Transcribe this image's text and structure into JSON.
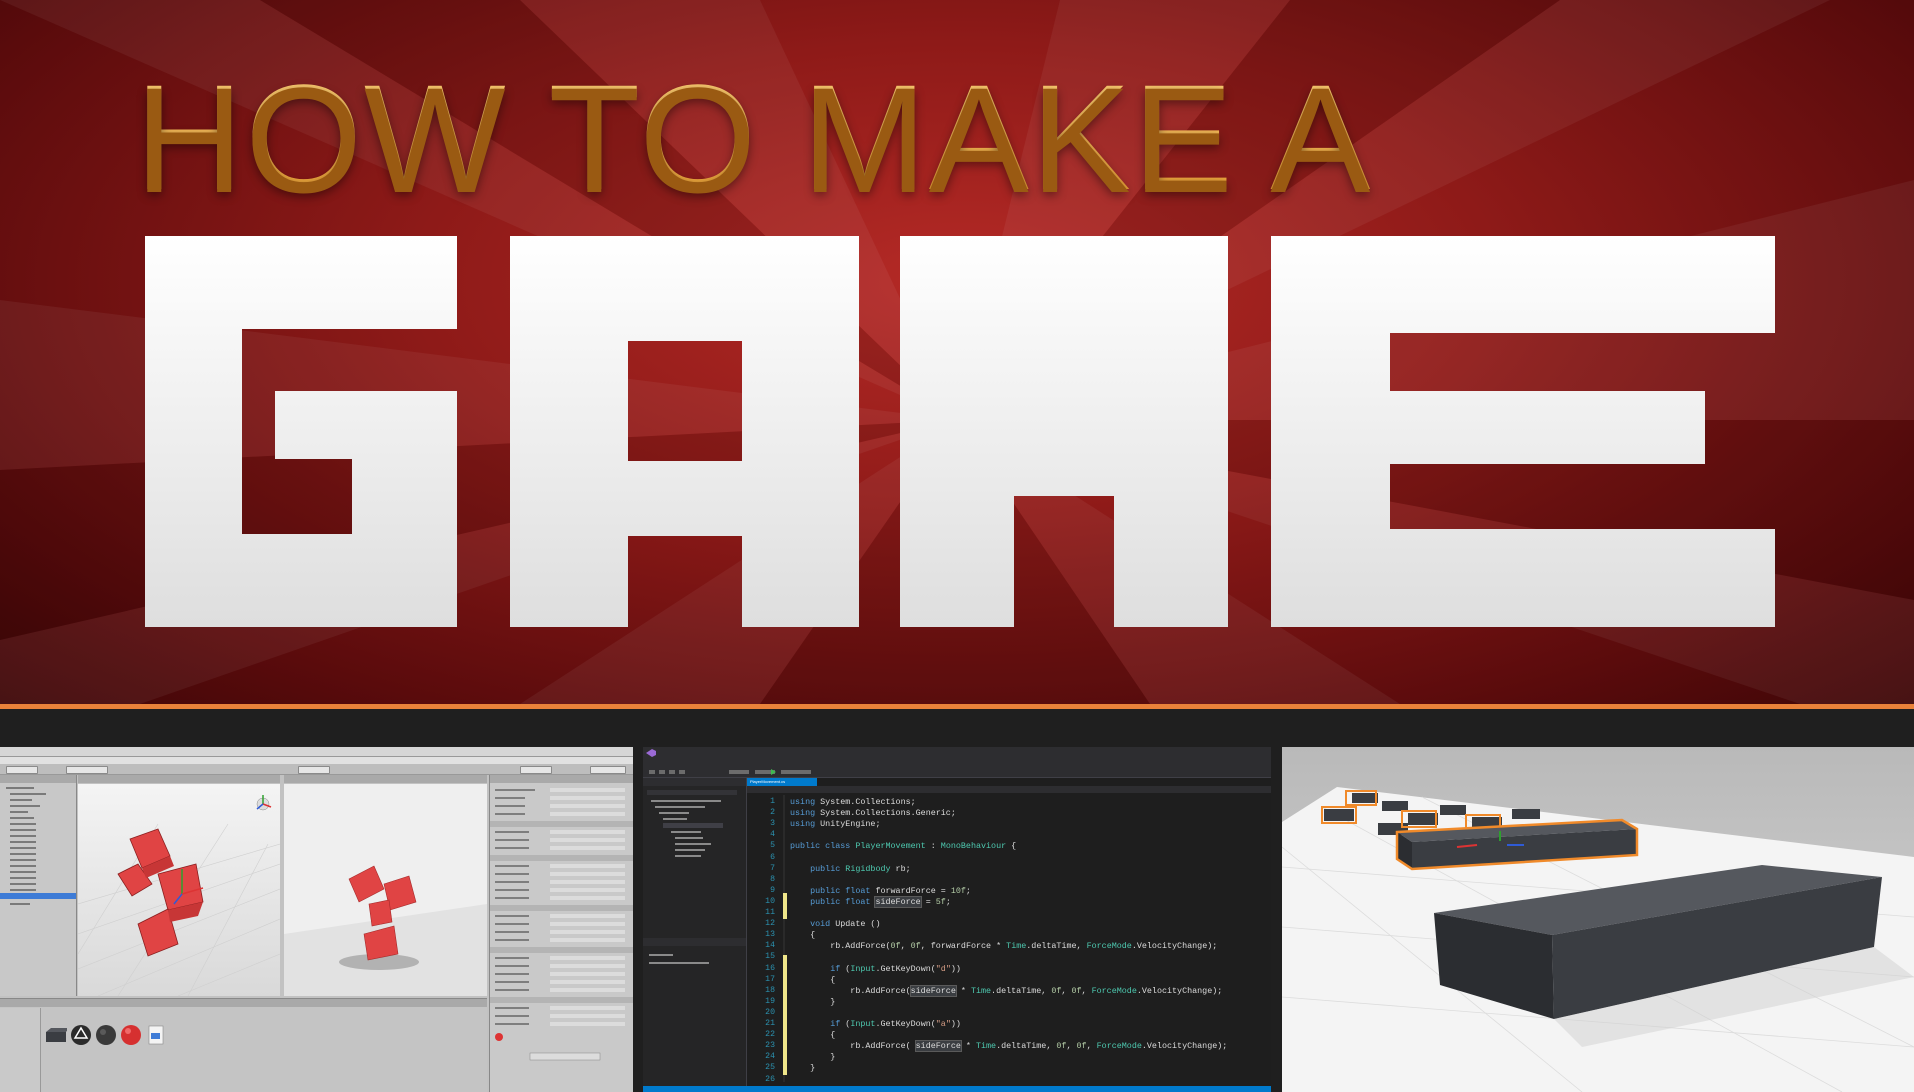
{
  "banner": {
    "subtitle": "HOW TO MAKE A",
    "title": "GAME",
    "colors": {
      "background": "#8e1a18",
      "subtitle": "#f3b24e",
      "title": "#f2f2f2",
      "rule": "#e9823a"
    }
  },
  "code_editor": {
    "tab": "PlayerMovement.cs",
    "lines": [
      {
        "n": "1",
        "segments": [
          {
            "t": "using ",
            "c": "kw"
          },
          {
            "t": "System.Collections;",
            "c": ""
          }
        ]
      },
      {
        "n": "2",
        "segments": [
          {
            "t": "using ",
            "c": "kw"
          },
          {
            "t": "System.Collections.Generic;",
            "c": ""
          }
        ]
      },
      {
        "n": "3",
        "segments": [
          {
            "t": "using ",
            "c": "kw"
          },
          {
            "t": "UnityEngine;",
            "c": ""
          }
        ]
      },
      {
        "n": "4",
        "segments": []
      },
      {
        "n": "5",
        "segments": [
          {
            "t": "public class ",
            "c": "kw"
          },
          {
            "t": "PlayerMovement",
            "c": "ty"
          },
          {
            "t": " : ",
            "c": ""
          },
          {
            "t": "MonoBehaviour",
            "c": "ty"
          },
          {
            "t": " {",
            "c": ""
          }
        ]
      },
      {
        "n": "6",
        "segments": []
      },
      {
        "n": "7",
        "segments": [
          {
            "t": "    public ",
            "c": "kw"
          },
          {
            "t": "Rigidbody",
            "c": "ty"
          },
          {
            "t": " rb;",
            "c": ""
          }
        ]
      },
      {
        "n": "8",
        "segments": []
      },
      {
        "n": "9",
        "segments": [
          {
            "t": "    public float ",
            "c": "kw"
          },
          {
            "t": "forwardForce = ",
            "c": ""
          },
          {
            "t": "10f",
            "c": "nm"
          },
          {
            "t": ";",
            "c": ""
          }
        ]
      },
      {
        "n": "10",
        "segments": [
          {
            "t": "    public float ",
            "c": "kw"
          },
          {
            "t": "sideForce",
            "c": "hl"
          },
          {
            "t": " = ",
            "c": ""
          },
          {
            "t": "5f",
            "c": "nm"
          },
          {
            "t": ";",
            "c": ""
          }
        ]
      },
      {
        "n": "11",
        "segments": []
      },
      {
        "n": "12",
        "segments": [
          {
            "t": "    void ",
            "c": "kw"
          },
          {
            "t": "Update ()",
            "c": ""
          }
        ]
      },
      {
        "n": "13",
        "segments": [
          {
            "t": "    {",
            "c": ""
          }
        ]
      },
      {
        "n": "14",
        "segments": [
          {
            "t": "        rb.AddForce(",
            "c": ""
          },
          {
            "t": "0f",
            "c": "nm"
          },
          {
            "t": ", ",
            "c": ""
          },
          {
            "t": "0f",
            "c": "nm"
          },
          {
            "t": ", forwardForce * ",
            "c": ""
          },
          {
            "t": "Time",
            "c": "ty"
          },
          {
            "t": ".deltaTime, ",
            "c": ""
          },
          {
            "t": "ForceMode",
            "c": "ty"
          },
          {
            "t": ".VelocityChange);",
            "c": ""
          }
        ]
      },
      {
        "n": "15",
        "segments": []
      },
      {
        "n": "16",
        "segments": [
          {
            "t": "        if ",
            "c": "kw"
          },
          {
            "t": "(",
            "c": ""
          },
          {
            "t": "Input",
            "c": "ty"
          },
          {
            "t": ".GetKeyDown(",
            "c": ""
          },
          {
            "t": "\"d\"",
            "c": "st"
          },
          {
            "t": "))",
            "c": ""
          }
        ]
      },
      {
        "n": "17",
        "segments": [
          {
            "t": "        {",
            "c": ""
          }
        ]
      },
      {
        "n": "18",
        "segments": [
          {
            "t": "            rb.AddForce(",
            "c": ""
          },
          {
            "t": "sideForce",
            "c": "hl"
          },
          {
            "t": " * ",
            "c": ""
          },
          {
            "t": "Time",
            "c": "ty"
          },
          {
            "t": ".deltaTime, ",
            "c": ""
          },
          {
            "t": "0f",
            "c": "nm"
          },
          {
            "t": ", ",
            "c": ""
          },
          {
            "t": "0f",
            "c": "nm"
          },
          {
            "t": ", ",
            "c": ""
          },
          {
            "t": "ForceMode",
            "c": "ty"
          },
          {
            "t": ".VelocityChange);",
            "c": ""
          }
        ]
      },
      {
        "n": "19",
        "segments": [
          {
            "t": "        }",
            "c": ""
          }
        ]
      },
      {
        "n": "20",
        "segments": []
      },
      {
        "n": "21",
        "segments": [
          {
            "t": "        if ",
            "c": "kw"
          },
          {
            "t": "(",
            "c": ""
          },
          {
            "t": "Input",
            "c": "ty"
          },
          {
            "t": ".GetKeyDown(",
            "c": ""
          },
          {
            "t": "\"a\"",
            "c": "st"
          },
          {
            "t": "))",
            "c": ""
          }
        ]
      },
      {
        "n": "22",
        "segments": [
          {
            "t": "        {",
            "c": ""
          }
        ]
      },
      {
        "n": "23",
        "segments": [
          {
            "t": "            rb.AddForce( ",
            "c": ""
          },
          {
            "t": "sideForce",
            "c": "hl"
          },
          {
            "t": " * ",
            "c": ""
          },
          {
            "t": "Time",
            "c": "ty"
          },
          {
            "t": ".deltaTime, ",
            "c": ""
          },
          {
            "t": "0f",
            "c": "nm"
          },
          {
            "t": ", ",
            "c": ""
          },
          {
            "t": "0f",
            "c": "nm"
          },
          {
            "t": ", ",
            "c": ""
          },
          {
            "t": "ForceMode",
            "c": "ty"
          },
          {
            "t": ".VelocityChange);",
            "c": ""
          }
        ]
      },
      {
        "n": "24",
        "segments": [
          {
            "t": "        }",
            "c": ""
          }
        ]
      },
      {
        "n": "25",
        "segments": [
          {
            "t": "    }",
            "c": ""
          }
        ]
      },
      {
        "n": "26",
        "segments": []
      }
    ]
  },
  "unity_editor": {
    "scene_cube_color": "#e04444",
    "asset_icons": [
      "material-icon",
      "unity-logo-icon",
      "dark-material-icon",
      "red-sphere-icon",
      "script-icon"
    ]
  },
  "scene_view": {
    "obstacle_color": "#3a3d42",
    "selection_color": "#f08a2a"
  }
}
